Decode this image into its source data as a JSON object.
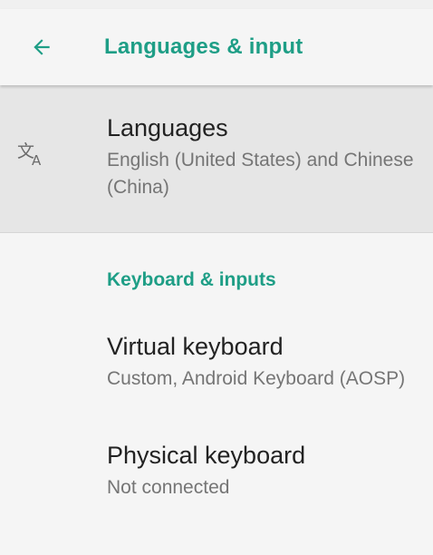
{
  "header": {
    "back_icon": "arrow-back-icon",
    "title": "Languages & input"
  },
  "colors": {
    "accent": "#1e9e86",
    "highlight_background": "#e6e6e6",
    "primary_text": "#222222",
    "secondary_text": "#757575"
  },
  "languages": {
    "icon": "translate-icon",
    "title": "Languages",
    "summary": "English (United States) and Chinese (China)"
  },
  "keyboard_section": {
    "header": "Keyboard & inputs",
    "items": [
      {
        "title": "Virtual keyboard",
        "summary": "Custom, Android Keyboard (AOSP)"
      },
      {
        "title": "Physical keyboard",
        "summary": "Not connected"
      }
    ]
  }
}
